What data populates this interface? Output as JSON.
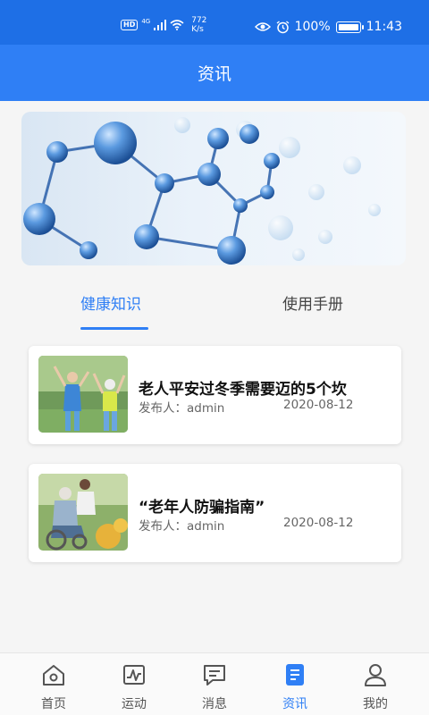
{
  "status_bar": {
    "hd": "HD",
    "network": "4G",
    "speed_value": "772",
    "speed_unit": "K/s",
    "battery": "100%",
    "time": "11:43"
  },
  "header": {
    "title": "资讯"
  },
  "tabs": [
    {
      "label": "健康知识",
      "active": true
    },
    {
      "label": "使用手册",
      "active": false
    }
  ],
  "articles": [
    {
      "title": "老人平安过冬季需要迈的5个坎",
      "author": "发布人：admin",
      "date": "2020-08-12"
    },
    {
      "title": "“老年人防骗指南”",
      "author": "发布人：admin",
      "date": "2020-08-12"
    }
  ],
  "nav": [
    {
      "label": "首页",
      "icon": "home-icon"
    },
    {
      "label": "运动",
      "icon": "activity-chart-icon"
    },
    {
      "label": "消息",
      "icon": "message-icon"
    },
    {
      "label": "资讯",
      "icon": "news-document-icon",
      "active": true
    },
    {
      "label": "我的",
      "icon": "profile-icon"
    }
  ],
  "colors": {
    "status_bar": "#1e6fe6",
    "header": "#2f7ff5",
    "accent": "#2f7ff5"
  }
}
